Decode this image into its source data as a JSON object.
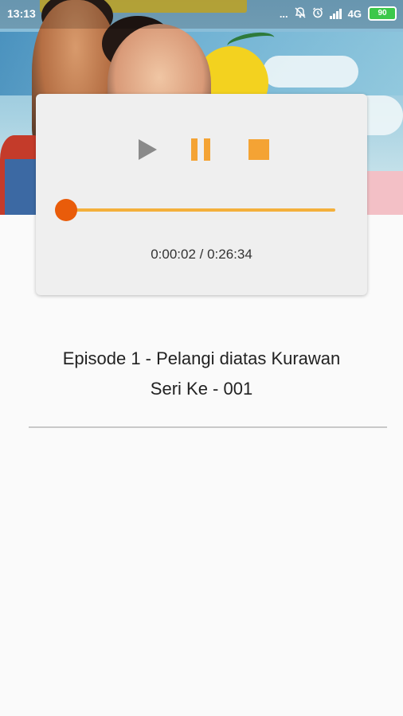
{
  "status_bar": {
    "time": "13:13",
    "dots": "...",
    "network": "4G",
    "battery": "90"
  },
  "player": {
    "play_icon": "play-icon",
    "pause_icon": "pause-icon",
    "stop_icon": "stop-icon",
    "current_time": "0:00:02",
    "total_time": "0:26:34",
    "time_readout": "0:00:02 / 0:26:34",
    "progress": 0.0013,
    "colors": {
      "play": "#8a8a8a",
      "pause": "#f4a334",
      "stop": "#f4a334",
      "track": "#f4b03c",
      "thumb": "#e95c0a"
    }
  },
  "episode": {
    "title": "Episode 1 - Pelangi diatas Kurawan",
    "series": "Seri Ke - 001"
  }
}
